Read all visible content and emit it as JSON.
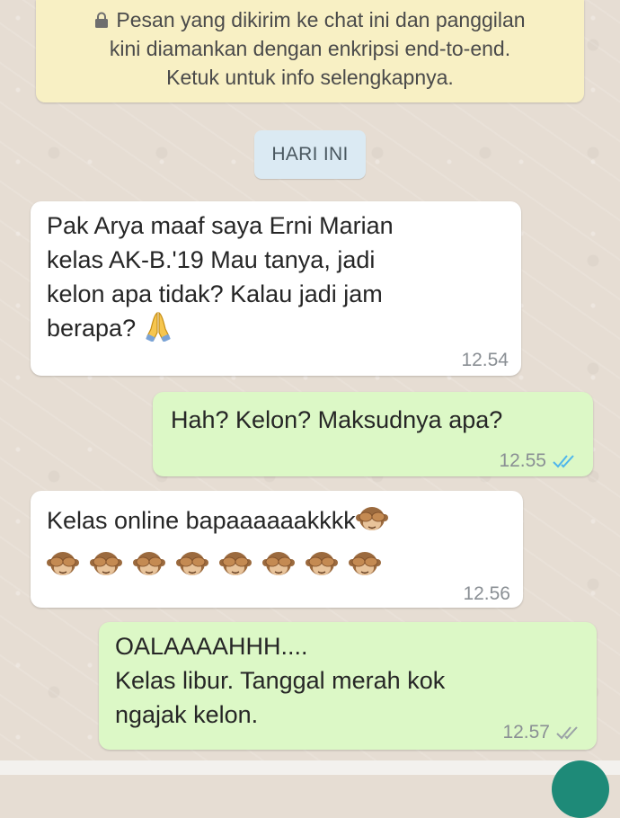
{
  "encryption_notice": {
    "line1": "Pesan yang dikirim ke chat ini dan panggilan",
    "line2": "kini diamankan dengan enkripsi end-to-end.",
    "line3": "Ketuk untuk info selengkapnya.",
    "icon": "lock-icon"
  },
  "date_chip": "HARI INI",
  "messages": [
    {
      "direction": "incoming",
      "text": "Pak Arya maaf saya Erni Marian\nkelas AK-B.'19 Mau tanya, jadi\nkelon apa tidak? Kalau jadi jam\nberapa?",
      "emoji": "folded-hands",
      "time": "12.54"
    },
    {
      "direction": "outgoing",
      "text": "Hah? Kelon? Maksudnya apa?",
      "time": "12.55",
      "status": "read"
    },
    {
      "direction": "incoming",
      "text": "Kelas online bapaaaaaakkkk",
      "emoji": "see-no-evil-monkey",
      "emoji_count": 9,
      "time": "12.56"
    },
    {
      "direction": "outgoing",
      "line1": "OALAAAAHHH....",
      "line2": "Kelas libur. Tanggal merah kok",
      "line3": "ngajak kelon.",
      "time": "12.57",
      "status": "read"
    }
  ],
  "colors": {
    "chat_background": "#e6ddd3",
    "incoming_bubble": "#ffffff",
    "outgoing_bubble": "#dcf8c6",
    "notice_background": "#f8f0c4",
    "date_chip_background": "#dbeaf3",
    "read_tick": "#4fb6ec"
  }
}
